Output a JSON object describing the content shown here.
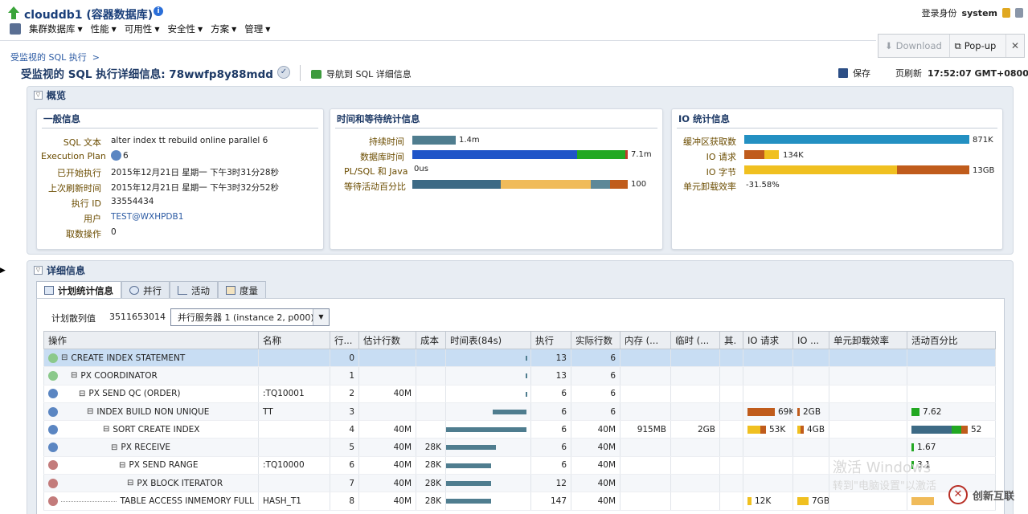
{
  "header": {
    "title": "clouddb1 (容器数据库)",
    "menus": [
      "集群数据库",
      "性能",
      "可用性",
      "安全性",
      "方案",
      "管理"
    ],
    "login_label": "登录身份",
    "login_user": "system"
  },
  "popup": {
    "download": "Download",
    "popup": "Pop-up"
  },
  "breadcrumb": "受监视的 SQL 执行",
  "page": {
    "title": "受监视的 SQL 执行详细信息: 78wwfp8y88mdd",
    "nav_link": "导航到 SQL 详细信息",
    "save": "保存",
    "refresh_label": "页刷新",
    "refresh_time": "17:52:07 GMT+0800"
  },
  "overview": {
    "title": "概览",
    "general": {
      "title": "一般信息",
      "rows": [
        {
          "label": "SQL 文本",
          "value": "alter index tt rebuild online parallel 6"
        },
        {
          "label": "Execution Plan",
          "value": "6"
        },
        {
          "label": "已开始执行",
          "value": "2015年12月21日 星期一 下午3时31分28秒"
        },
        {
          "label": "上次刷新时间",
          "value": "2015年12月21日 星期一 下午3时32分52秒"
        },
        {
          "label": "执行 ID",
          "value": "33554434"
        },
        {
          "label": "用户",
          "value": "TEST@WXHPDB1"
        },
        {
          "label": "取数操作",
          "value": "0"
        }
      ]
    },
    "time": {
      "title": "时间和等待统计信息",
      "rows": [
        {
          "label": "持续时间",
          "value": "1.4m"
        },
        {
          "label": "数据库时间",
          "value": "7.1m"
        },
        {
          "label": "PL/SQL 和 Java",
          "value": "0us"
        },
        {
          "label": "等待活动百分比",
          "value": "100"
        }
      ]
    },
    "io": {
      "title": "IO 统计信息",
      "rows": [
        {
          "label": "缓冲区获取数",
          "value": "871K"
        },
        {
          "label": "IO 请求",
          "value": "134K"
        },
        {
          "label": "IO 字节",
          "value": "13GB"
        },
        {
          "label": "单元卸载效率",
          "value": "-31.58%"
        }
      ]
    }
  },
  "detail": {
    "title": "详细信息",
    "tabs": [
      "计划统计信息",
      "并行",
      "活动",
      "度量"
    ],
    "plan_hash_label": "计划散列值",
    "plan_hash_value": "3511653014",
    "server_select": "并行服务器 1 (instance 2, p000)",
    "columns": [
      "操作",
      "名称",
      "行...",
      "估计行数",
      "成本",
      "时间表(84s)",
      "执行",
      "实际行数",
      "内存 (...",
      "临时 (...",
      "其.",
      "IO 请求",
      "IO ...",
      "单元卸载效率",
      "活动百分比"
    ],
    "rows": [
      {
        "op": "CREATE INDEX STATEMENT",
        "name": "",
        "line": "0",
        "est": "",
        "cost": "",
        "exec": "13",
        "actual": "6",
        "mem": "",
        "temp": "",
        "ioreq": "",
        "iobytes": "",
        "act": ""
      },
      {
        "op": "PX COORDINATOR",
        "name": "",
        "line": "1",
        "est": "",
        "cost": "",
        "exec": "13",
        "actual": "6",
        "mem": "",
        "temp": "",
        "ioreq": "",
        "iobytes": "",
        "act": ""
      },
      {
        "op": "PX SEND QC (ORDER)",
        "name": ":TQ10001",
        "line": "2",
        "est": "40M",
        "cost": "",
        "exec": "6",
        "actual": "6",
        "mem": "",
        "temp": "",
        "ioreq": "",
        "iobytes": "",
        "act": ""
      },
      {
        "op": "INDEX BUILD NON UNIQUE",
        "name": "TT",
        "line": "3",
        "est": "",
        "cost": "",
        "exec": "6",
        "actual": "6",
        "mem": "",
        "temp": "",
        "ioreq": "69K",
        "iobytes": "2GB",
        "act": "7.62"
      },
      {
        "op": "SORT CREATE INDEX",
        "name": "",
        "line": "4",
        "est": "40M",
        "cost": "",
        "exec": "6",
        "actual": "40M",
        "mem": "915MB",
        "temp": "2GB",
        "ioreq": "53K",
        "iobytes": "4GB",
        "act": "52"
      },
      {
        "op": "PX RECEIVE",
        "name": "",
        "line": "5",
        "est": "40M",
        "cost": "28K",
        "exec": "6",
        "actual": "40M",
        "mem": "",
        "temp": "",
        "ioreq": "",
        "iobytes": "",
        "act": "1.67"
      },
      {
        "op": "PX SEND RANGE",
        "name": ":TQ10000",
        "line": "6",
        "est": "40M",
        "cost": "28K",
        "exec": "6",
        "actual": "40M",
        "mem": "",
        "temp": "",
        "ioreq": "",
        "iobytes": "",
        "act": "3.1"
      },
      {
        "op": "PX BLOCK ITERATOR",
        "name": "",
        "line": "7",
        "est": "40M",
        "cost": "28K",
        "exec": "12",
        "actual": "40M",
        "mem": "",
        "temp": "",
        "ioreq": "",
        "iobytes": "",
        "act": ""
      },
      {
        "op": "TABLE ACCESS INMEMORY FULL",
        "name": "HASH_T1",
        "line": "8",
        "est": "40M",
        "cost": "28K",
        "exec": "147",
        "actual": "40M",
        "mem": "",
        "temp": "",
        "ioreq": "12K",
        "iobytes": "7GB",
        "act": ""
      }
    ]
  },
  "watermark": {
    "line1": "激活 Windows",
    "line2": "转到\"电脑设置\"以激活",
    "brand": "创新互联"
  }
}
